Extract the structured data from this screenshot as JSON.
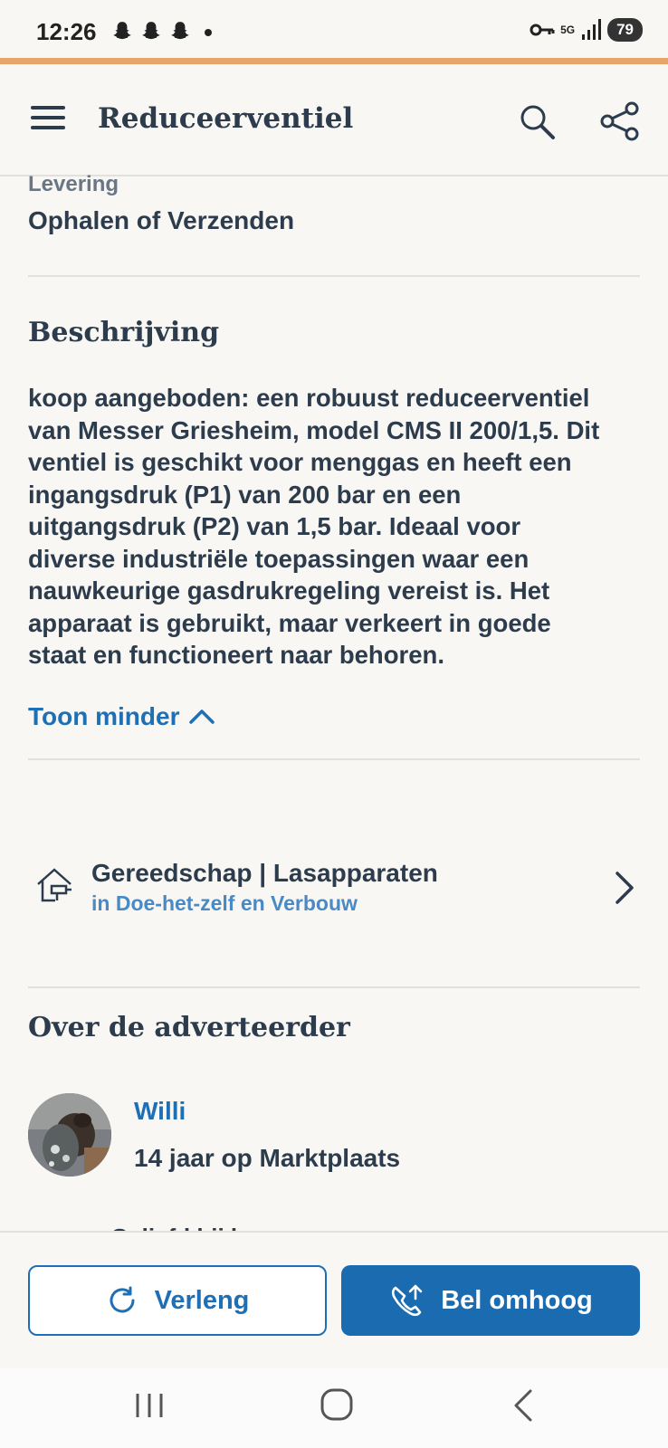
{
  "status_bar": {
    "time": "12:26",
    "network": "5G",
    "battery": "79"
  },
  "app_bar": {
    "title": "Reduceerventiel"
  },
  "delivery": {
    "label": "Levering",
    "value": "Ophalen of Verzenden"
  },
  "description": {
    "heading": "Beschrijving",
    "text": "koop aangeboden: een robuust reduceerventiel\nvan Messer Griesheim, model CMS II 200/1,5. Dit\nventiel is geschikt voor menggas en heeft een\ningangsdruk (P1) van 200 bar en een\nuitgangsdruk (P2) van 1,5 bar. Ideaal voor\ndiverse industriële toepassingen waar een\nnauwkeurige gasdrukregeling vereist is. Het\napparaat is gebruikt, maar verkeert in goede\nstaat en functioneert naar behoren.",
    "toggle_label": "Toon minder"
  },
  "category": {
    "title": "Gereedschap | Lasapparaten",
    "subtitle": "in Doe-het-zelf en Verbouw"
  },
  "advertiser": {
    "heading": "Over de adverteerder",
    "name": "Willi",
    "since": "14 jaar op Marktplaats",
    "partial_line": "Geliefd bij kopers"
  },
  "actions": {
    "extend_label": "Verleng",
    "bump_label": "Bel omhoog"
  },
  "colors": {
    "accent_line": "#e8a56a",
    "primary_blue": "#1b6bb0",
    "text_dark": "#2d3c4d"
  }
}
